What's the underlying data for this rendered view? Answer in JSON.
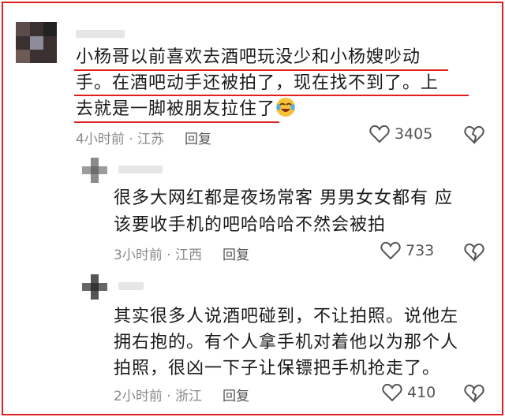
{
  "comments": [
    {
      "text_lines": [
        "小杨哥以前喜欢去酒吧玩没少和小杨嫂吵动",
        "手。在酒吧动手还被拍了，现在找不到了。上",
        "去就是一脚被朋友拉住了"
      ],
      "emoji": "laughing-crying-emoji",
      "time": "4小时前 · 江苏",
      "reply_label": "回复",
      "likes": "3405"
    },
    {
      "text_lines": [
        "很多大网红都是夜场常客 男男女女都有 应",
        "该要收手机的吧哈哈哈不然会被拍"
      ],
      "time": "3小时前 · 江西",
      "reply_label": "回复",
      "likes": "733"
    },
    {
      "text_lines": [
        "其实很多人说酒吧碰到，不让拍照。说他左",
        "拥右抱的。有个人拿手机对着他以为那个人",
        "拍照，很凶一下子让保镖把手机抢走了。"
      ],
      "time": "2小时前 · 浙江",
      "reply_label": "回复",
      "likes": "410"
    }
  ],
  "colors": {
    "highlight_border": "#e02020",
    "text": "#1a1a1a",
    "meta": "#8a8a8a"
  }
}
